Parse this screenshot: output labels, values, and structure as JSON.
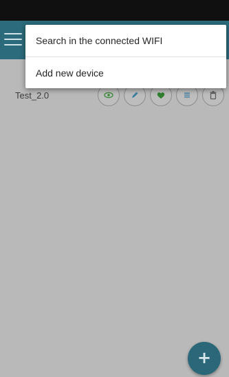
{
  "device_list": {
    "items": [
      {
        "name": "Test_2.0"
      }
    ]
  },
  "device_actions": [
    {
      "icon": "eye-icon"
    },
    {
      "icon": "pencil-icon"
    },
    {
      "icon": "heart-icon"
    },
    {
      "icon": "list-icon"
    },
    {
      "icon": "trash-icon"
    }
  ],
  "popup_menu": {
    "items": [
      {
        "label": "Search in the connected WIFI"
      },
      {
        "label": "Add new device"
      }
    ]
  },
  "fab": {
    "label": "+",
    "icon": "plus-icon"
  },
  "colors": {
    "app_bar": "#2b6b7b",
    "fab": "#2a6879",
    "accent_green": "#3c8a3c"
  }
}
